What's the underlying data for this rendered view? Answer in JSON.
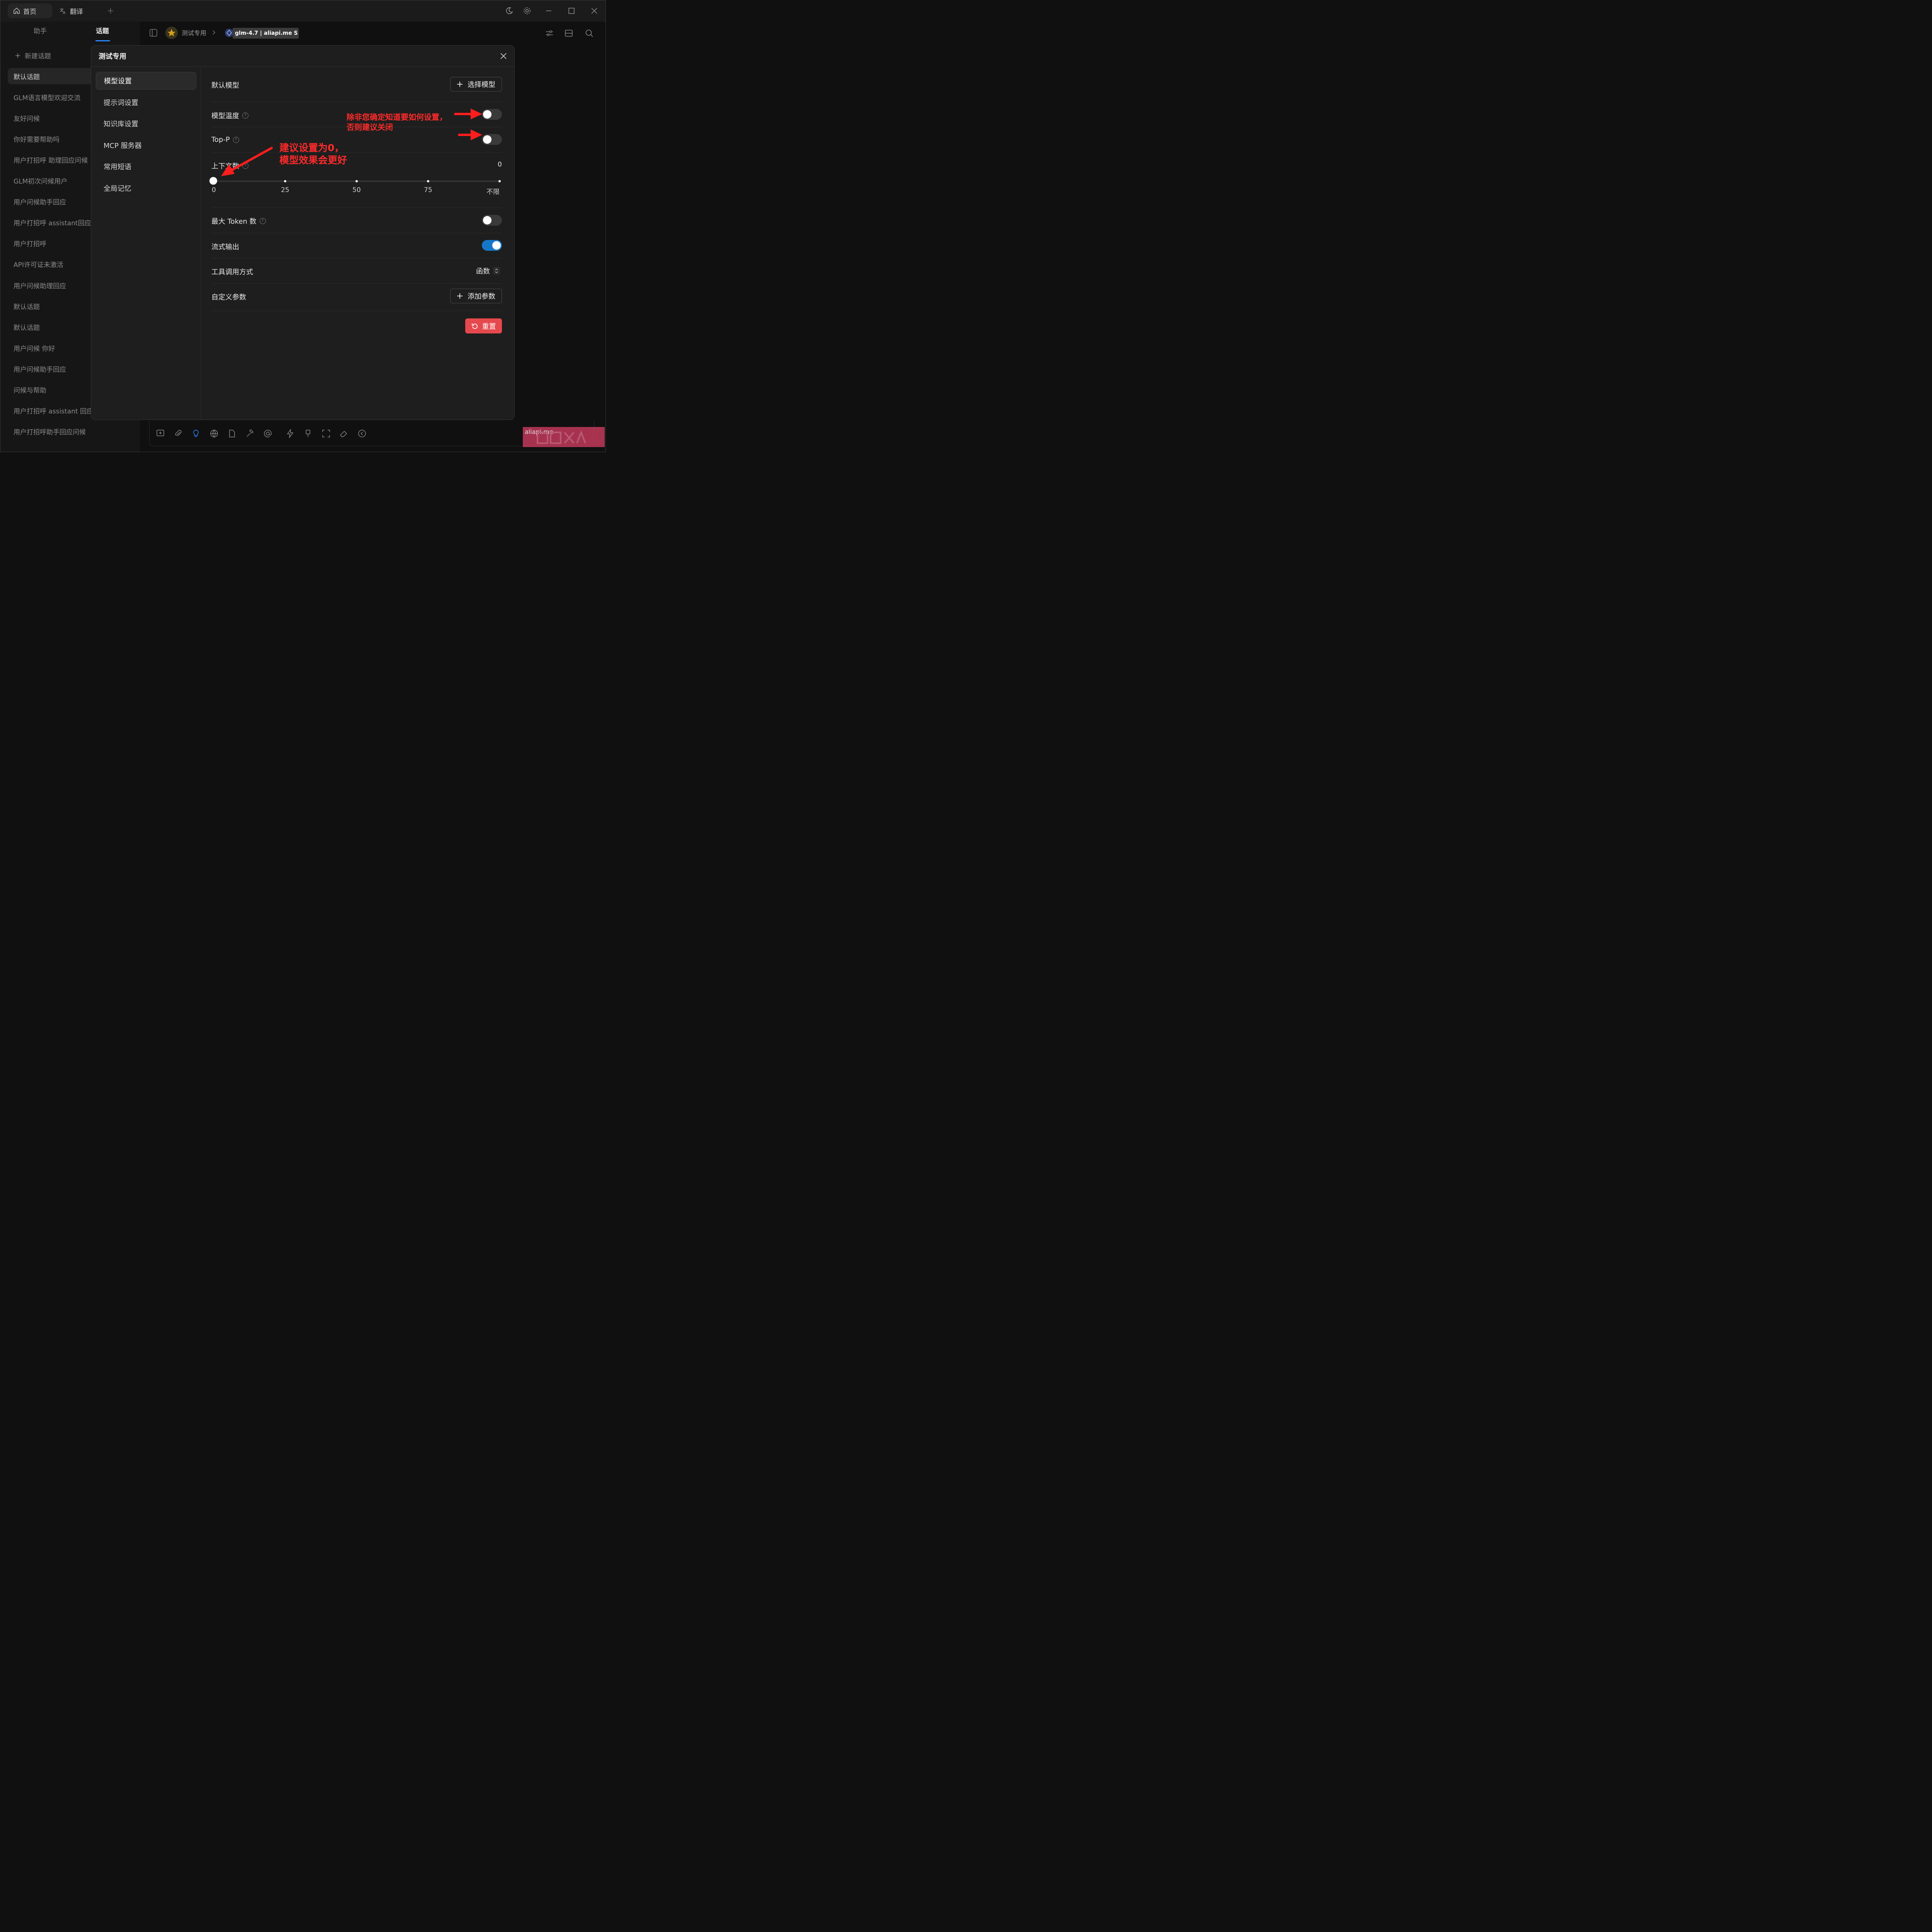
{
  "titlebar": {
    "tabs": [
      {
        "label": "首页",
        "icon": "home-icon"
      },
      {
        "label": "翻译",
        "icon": "translate-icon"
      }
    ]
  },
  "sidebar": {
    "tabs": [
      "助手",
      "话题"
    ],
    "active_tab": "话题",
    "new_topic": "新建话题",
    "topics": [
      "默认话题",
      "GLM语言模型欢迎交流",
      "友好问候",
      "你好需要帮助吗",
      "用户打招呼 助理回应问候",
      "GLM初次问候用户",
      "用户问候助手回应",
      "用户打招呼 assistant回应",
      "用户打招呼",
      "API许可证未激活",
      "用户问候助理回应",
      "默认话题",
      "默认话题",
      "用户问候 你好",
      "用户问候助手回应",
      "问候与帮助",
      "用户打招呼 assistant 回应问候",
      "用户打招呼助手回应问候"
    ]
  },
  "header": {
    "assistant_name": "测试专用",
    "model_label": "glm-4.7 | aliapi.me S"
  },
  "dialog": {
    "title": "测试专用",
    "menu": [
      "模型设置",
      "提示词设置",
      "知识库设置",
      "MCP 服务器",
      "常用短语",
      "全局记忆"
    ],
    "active_menu": "模型设置",
    "default_model_label": "默认模型",
    "select_model_button": "选择模型",
    "temperature_label": "模型温度",
    "temperature_enabled": false,
    "top_p_label": "Top-P",
    "top_p_enabled": false,
    "context_label": "上下文数",
    "context_value": "0",
    "context_slider": {
      "value": 0,
      "ticks": [
        "0",
        "25",
        "50",
        "75",
        "不限"
      ]
    },
    "max_tokens_label": "最大 Token 数",
    "max_tokens_enabled": false,
    "stream_label": "流式输出",
    "stream_enabled": true,
    "tool_call_label": "工具调用方式",
    "tool_call_value": "函数",
    "custom_params_label": "自定义参数",
    "add_param_button": "添加参数",
    "reset_button": "重置"
  },
  "annotations": {
    "note1_line1": "除非您确定知道要如何设置，",
    "note1_line2": "否则建议关闭",
    "note2_line1": "建议设置为0，",
    "note2_line2": "模型效果会更好",
    "color": "#ff2a2a"
  },
  "watermark": {
    "text": "aliapi.me"
  },
  "colors": {
    "accent": "#1677c9",
    "danger": "#e5484d",
    "tab_underline": "#2d89ff"
  }
}
